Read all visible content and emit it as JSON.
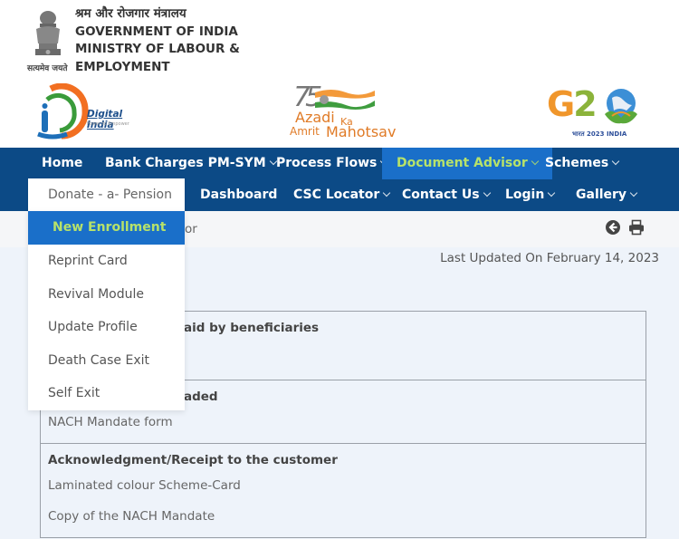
{
  "header": {
    "hindi_title": "श्रम और रोजगार मंत्रालय",
    "line1": "GOVERNMENT OF INDIA",
    "line2": "MINISTRY OF LABOUR &",
    "line3": "EMPLOYMENT",
    "emblem_motto": "सत्यमेव जयते"
  },
  "logos": {
    "digital_india": {
      "name": "Digital India",
      "tagline": "Power to Empower"
    },
    "azadi": {
      "number": "75",
      "line1": "Azadi",
      "ka": "Ka",
      "line2a": "Amrit",
      "line2b": "Mahotsav"
    },
    "g20": {
      "text": "G20",
      "subtitle": "भारत 2023 INDIA"
    }
  },
  "nav": {
    "row1": [
      {
        "label": "Home",
        "has_dropdown": false,
        "active": false
      },
      {
        "label": "Bank Charges PM-SYM",
        "has_dropdown": true,
        "active": false
      },
      {
        "label": "Process Flows",
        "has_dropdown": true,
        "active": false
      },
      {
        "label": "Document Advisor",
        "has_dropdown": true,
        "active": true
      },
      {
        "label": "Schemes",
        "has_dropdown": true,
        "active": false
      }
    ],
    "row2": [
      {
        "label": "Donate - a- Pension",
        "has_dropdown": false,
        "open": true
      },
      {
        "label": "Dashboard",
        "has_dropdown": false
      },
      {
        "label": "CSC Locator",
        "has_dropdown": true
      },
      {
        "label": "Contact Us",
        "has_dropdown": true
      },
      {
        "label": "Login",
        "has_dropdown": true
      },
      {
        "label": "Gallery",
        "has_dropdown": true
      }
    ]
  },
  "dropdown": {
    "items": [
      {
        "label": "New Enrollment",
        "active": true
      },
      {
        "label": "Reprint Card",
        "active": false
      },
      {
        "label": "Revival Module",
        "active": false
      },
      {
        "label": "Update Profile",
        "active": false
      },
      {
        "label": "Death Case Exit",
        "active": false
      },
      {
        "label": "Self Exit",
        "active": false
      }
    ]
  },
  "breadcrumb": {
    "visible_fragment": "or"
  },
  "toolbar": {
    "back_icon": "circle-arrow-left-icon",
    "print_icon": "printer-icon"
  },
  "last_updated": "Last Updated On February 14, 2023",
  "sections": [
    {
      "heading_visible": "aid by beneficiaries",
      "lines": []
    },
    {
      "heading_visible": "aded",
      "lines": [
        "NACH Mandate form"
      ]
    },
    {
      "heading_visible": "Acknowledgment/Receipt to the customer",
      "lines": [
        "Laminated colour Scheme-Card",
        "Copy of the NACH Mandate"
      ]
    }
  ],
  "colors": {
    "nav_bg": "#0c4a86",
    "active_bg": "#1a6fc9",
    "active_text": "#b7e26a",
    "content_bg": "#eef3fa"
  }
}
